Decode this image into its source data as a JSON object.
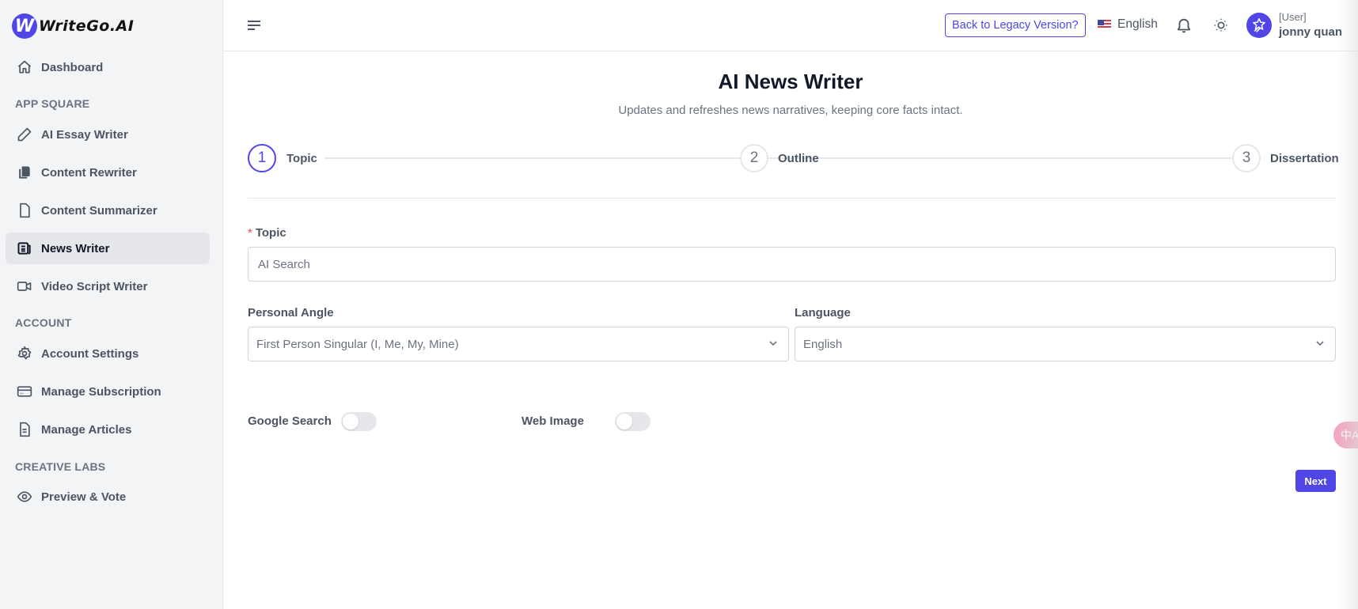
{
  "brand": {
    "logo_letter": "W",
    "name": "WriteGo.AI"
  },
  "sidebar": {
    "dashboard": "Dashboard",
    "sections": [
      {
        "title": "APP SQUARE"
      },
      {
        "title": "ACCOUNT"
      },
      {
        "title": "CREATIVE LABS"
      }
    ],
    "items": [
      {
        "label": "AI Essay Writer",
        "icon": "pencil-icon"
      },
      {
        "label": "Content Rewriter",
        "icon": "copy-icon"
      },
      {
        "label": "Content Summarizer",
        "icon": "document-icon"
      },
      {
        "label": "News Writer",
        "icon": "newspaper-icon",
        "active": true
      },
      {
        "label": "Video Script Writer",
        "icon": "video-icon"
      },
      {
        "label": "Account Settings",
        "icon": "gear-icon"
      },
      {
        "label": "Manage Subscription",
        "icon": "credit-card-icon"
      },
      {
        "label": "Manage Articles",
        "icon": "file-text-icon"
      },
      {
        "label": "Preview & Vote",
        "icon": "eye-icon"
      }
    ]
  },
  "header": {
    "legacy_button": "Back to Legacy Version?",
    "language": "English",
    "user_role": "[User]",
    "user_name": "jonny quan"
  },
  "page": {
    "title": "AI News Writer",
    "subtitle": "Updates and refreshes news narratives, keeping core facts intact."
  },
  "steps": [
    {
      "number": "1",
      "label": "Topic",
      "active": true
    },
    {
      "number": "2",
      "label": "Outline",
      "active": false
    },
    {
      "number": "3",
      "label": "Dissertation",
      "active": false
    }
  ],
  "form": {
    "topic_required_mark": "*",
    "topic_label": "Topic",
    "topic_placeholder": "AI Search",
    "topic_value": "",
    "personal_angle_label": "Personal Angle",
    "personal_angle_value": "First Person Singular (I, Me, My, Mine)",
    "language_label": "Language",
    "language_value": "English",
    "google_search_label": "Google Search",
    "google_search_on": false,
    "web_image_label": "Web Image",
    "web_image_on": false,
    "next_button": "Next"
  },
  "translate_fab": {
    "icon": "translate-icon",
    "glyph": "中A"
  },
  "colors": {
    "accent": "#4f46e5",
    "required": "#ef4444",
    "sidebar_bg": "#f3f4f6",
    "translate_fab": "#f0a9c0"
  }
}
